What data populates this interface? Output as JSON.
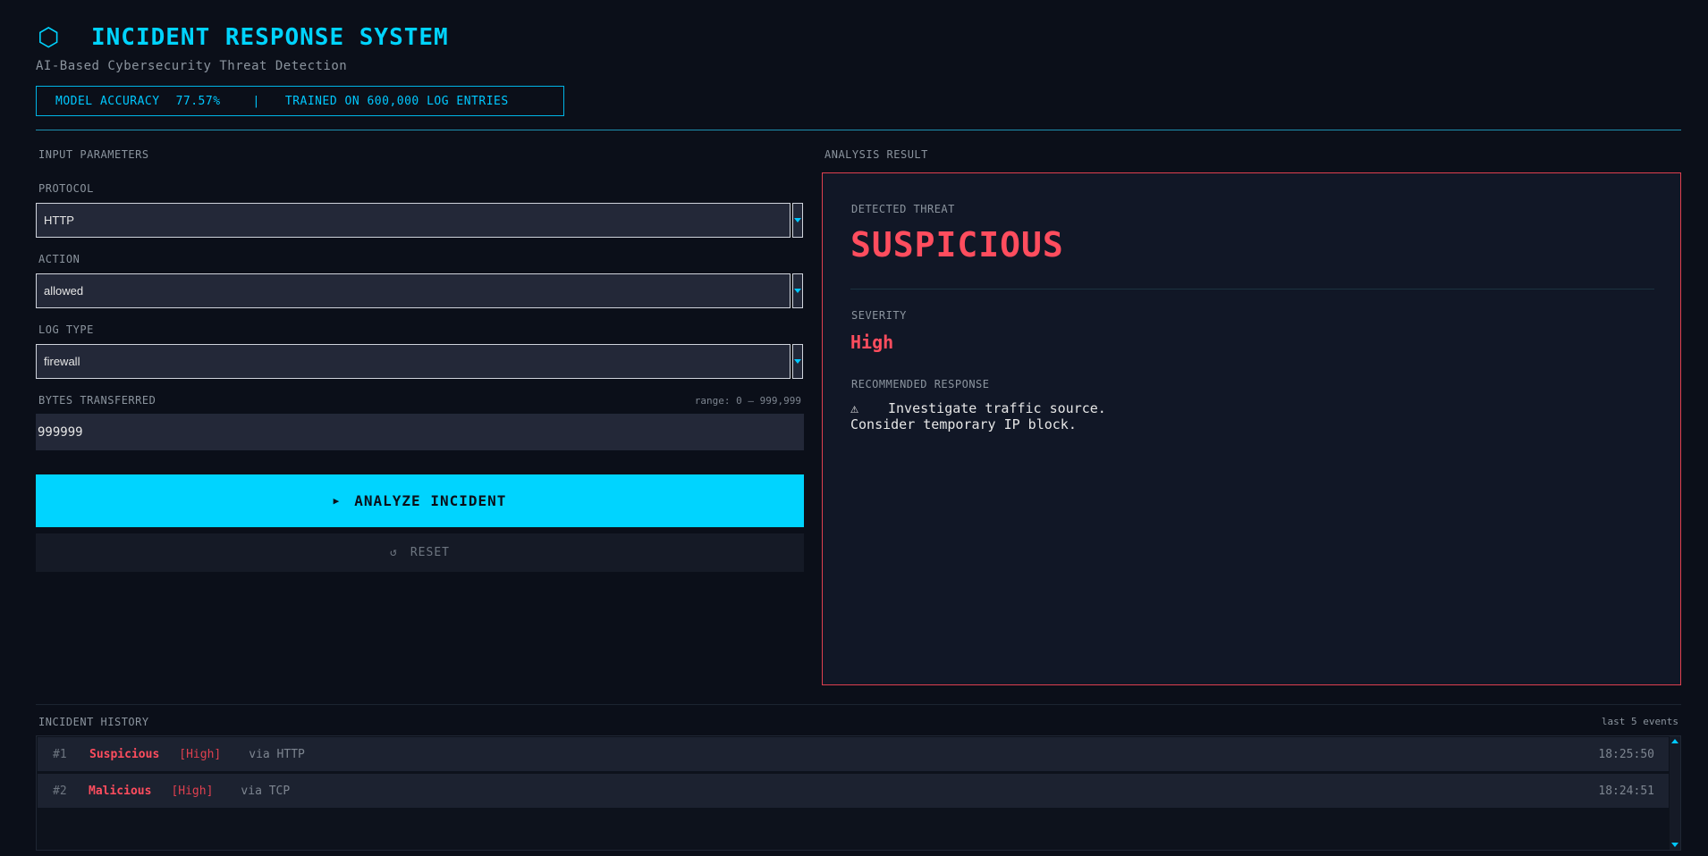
{
  "header": {
    "icon": "hexagon-icon",
    "title": "INCIDENT RESPONSE SYSTEM",
    "subtitle": "AI-Based Cybersecurity Threat Detection",
    "accuracy_label": "MODEL ACCURACY",
    "accuracy_value": "77.57%",
    "separator": "|",
    "trained_label": "TRAINED ON 600,000 LOG ENTRIES"
  },
  "input": {
    "section_label": "INPUT PARAMETERS",
    "protocol": {
      "label": "PROTOCOL",
      "value": "HTTP"
    },
    "action": {
      "label": "ACTION",
      "value": "allowed"
    },
    "log_type": {
      "label": "LOG TYPE",
      "value": "firewall"
    },
    "bytes": {
      "label": "BYTES TRANSFERRED",
      "range": "range: 0 – 999,999",
      "value": "999999"
    },
    "analyze_label": "ANALYZE INCIDENT",
    "analyze_icon": "▶",
    "reset_label": "RESET",
    "reset_icon": "↺"
  },
  "result": {
    "section_label": "ANALYSIS RESULT",
    "threat_label": "DETECTED THREAT",
    "threat_value": "SUSPICIOUS",
    "severity_label": "SEVERITY",
    "severity_value": "High",
    "response_label": "RECOMMENDED RESPONSE",
    "response_icon": "⚠",
    "response_line1": "Investigate traffic source.",
    "response_line2": "Consider temporary IP block."
  },
  "history": {
    "section_label": "INCIDENT HISTORY",
    "note": "last 5 events",
    "rows": [
      {
        "num": "#1",
        "type": "Suspicious",
        "severity": "[High]",
        "via": "via HTTP",
        "time": "18:25:50"
      },
      {
        "num": "#2",
        "type": "Malicious",
        "severity": "[High]",
        "via": "via TCP",
        "time": "18:24:51"
      }
    ]
  },
  "colors": {
    "accent": "#00d4ff",
    "danger": "#ff4d5e",
    "background": "#0b0f19"
  }
}
